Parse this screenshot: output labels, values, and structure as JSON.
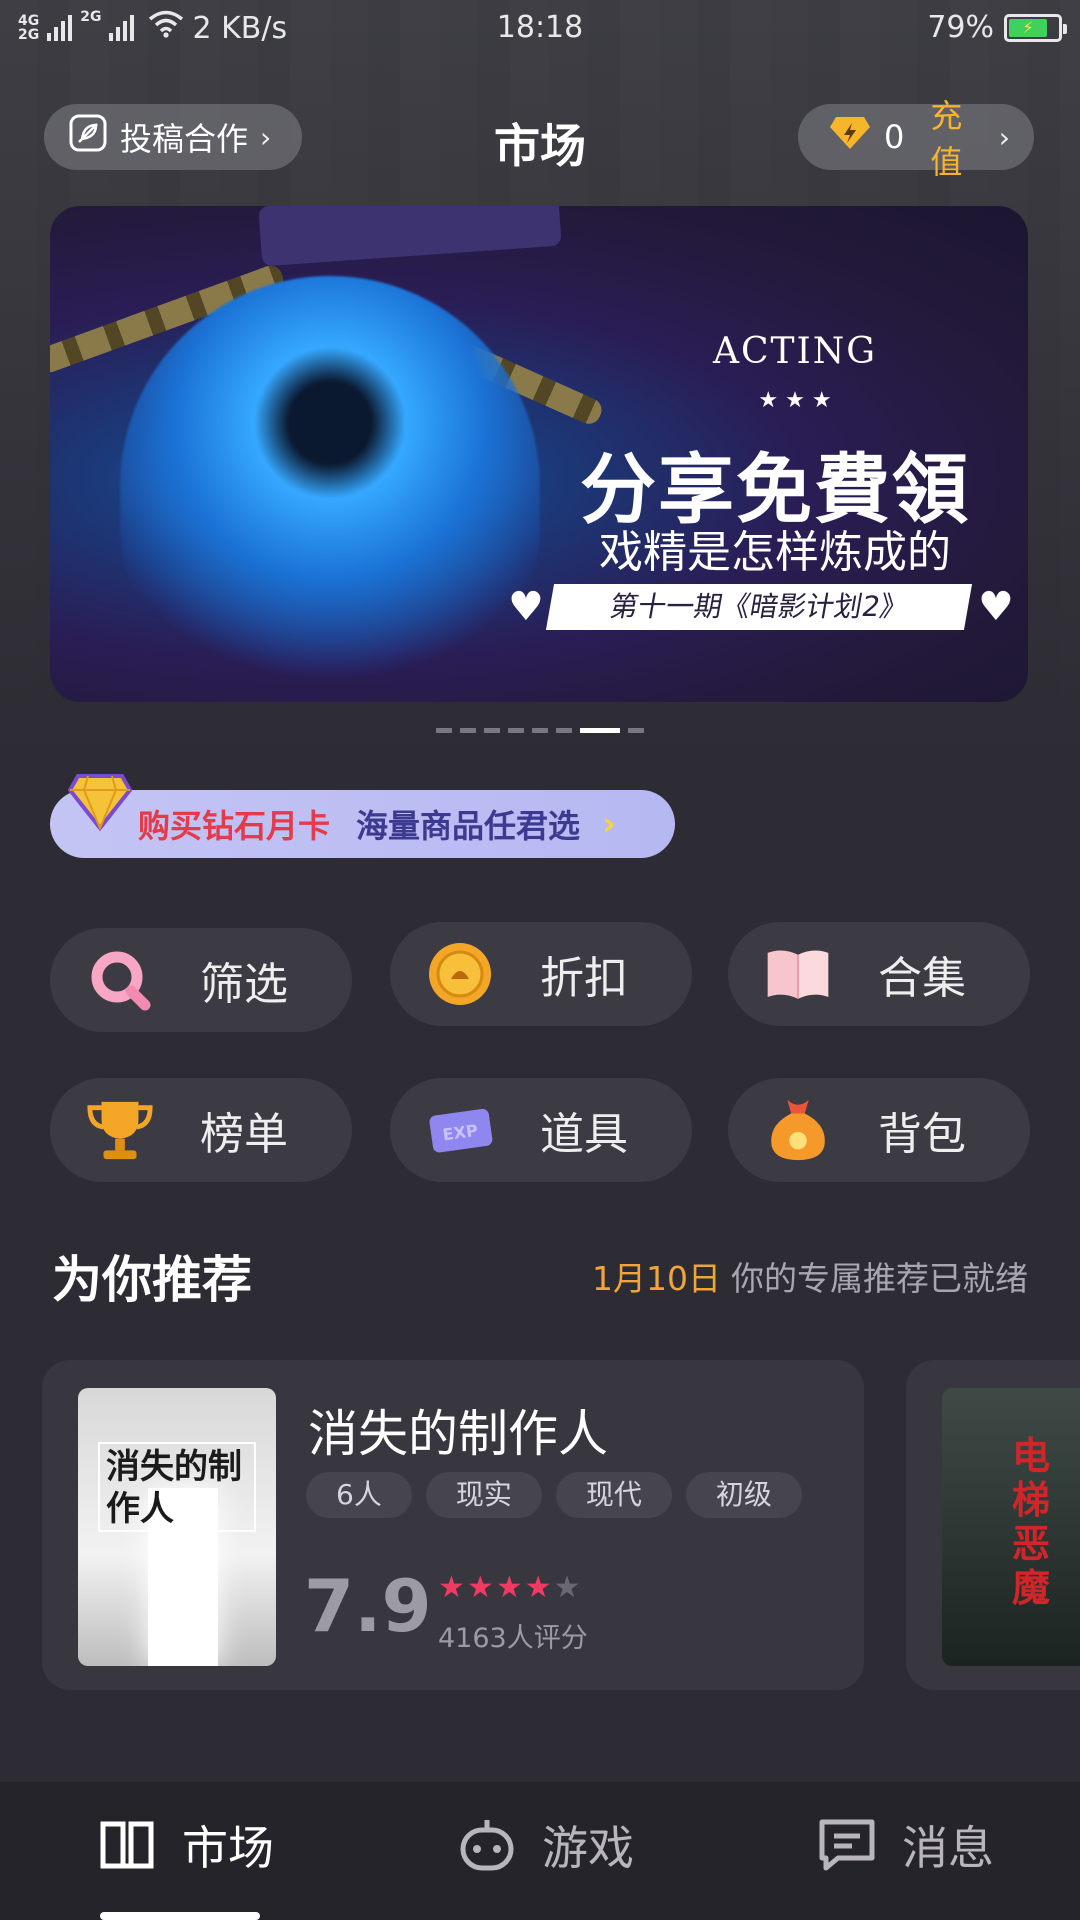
{
  "status_bar": {
    "net_top": "4G",
    "net_bottom": "2G",
    "net_2g": "2G",
    "speed": "2 KB/s",
    "time": "18:18",
    "battery": "79%"
  },
  "header": {
    "left_button": "投稿合作",
    "title": "市场",
    "diamond_count": "0",
    "recharge_label": "充值"
  },
  "banner": {
    "eyebrow": "ACTING",
    "stars": "★  ★  ★",
    "headline": "分享免費領",
    "subline": "戏精是怎样炼成的",
    "ribbon": "第十一期《暗影计划2》",
    "page_count": 8,
    "active_index": 6
  },
  "promo": {
    "label_red": "购买钻石月卡",
    "label_blue": "海量商品任君选"
  },
  "features": [
    {
      "label": "筛选",
      "icon": "search-icon"
    },
    {
      "label": "折扣",
      "icon": "coin-icon"
    },
    {
      "label": "合集",
      "icon": "book-icon"
    },
    {
      "label": "榜单",
      "icon": "trophy-icon"
    },
    {
      "label": "道具",
      "icon": "exp-ticket-icon"
    },
    {
      "label": "背包",
      "icon": "money-bag-icon"
    }
  ],
  "recommend": {
    "title": "为你推荐",
    "date": "1月10日",
    "note": "你的专属推荐已就绪",
    "cards": [
      {
        "title": "消失的制作人",
        "cover_text": "消失的制作人",
        "tags": [
          "6人",
          "现实",
          "现代",
          "初级"
        ],
        "score": "7.9",
        "stars": 4,
        "raters": "4163人评分"
      },
      {
        "cover_text": "电梯恶魔"
      }
    ]
  },
  "bottom_nav": [
    {
      "label": "市场",
      "icon": "book-open-icon",
      "active": true
    },
    {
      "label": "游戏",
      "icon": "gamepad-icon",
      "active": false
    },
    {
      "label": "消息",
      "icon": "chat-icon",
      "active": false
    }
  ],
  "colors": {
    "accent_gold": "#f6b52a",
    "star_red": "#f03a62",
    "promo_red": "#e53a4a",
    "promo_blue": "#3c3a90"
  }
}
